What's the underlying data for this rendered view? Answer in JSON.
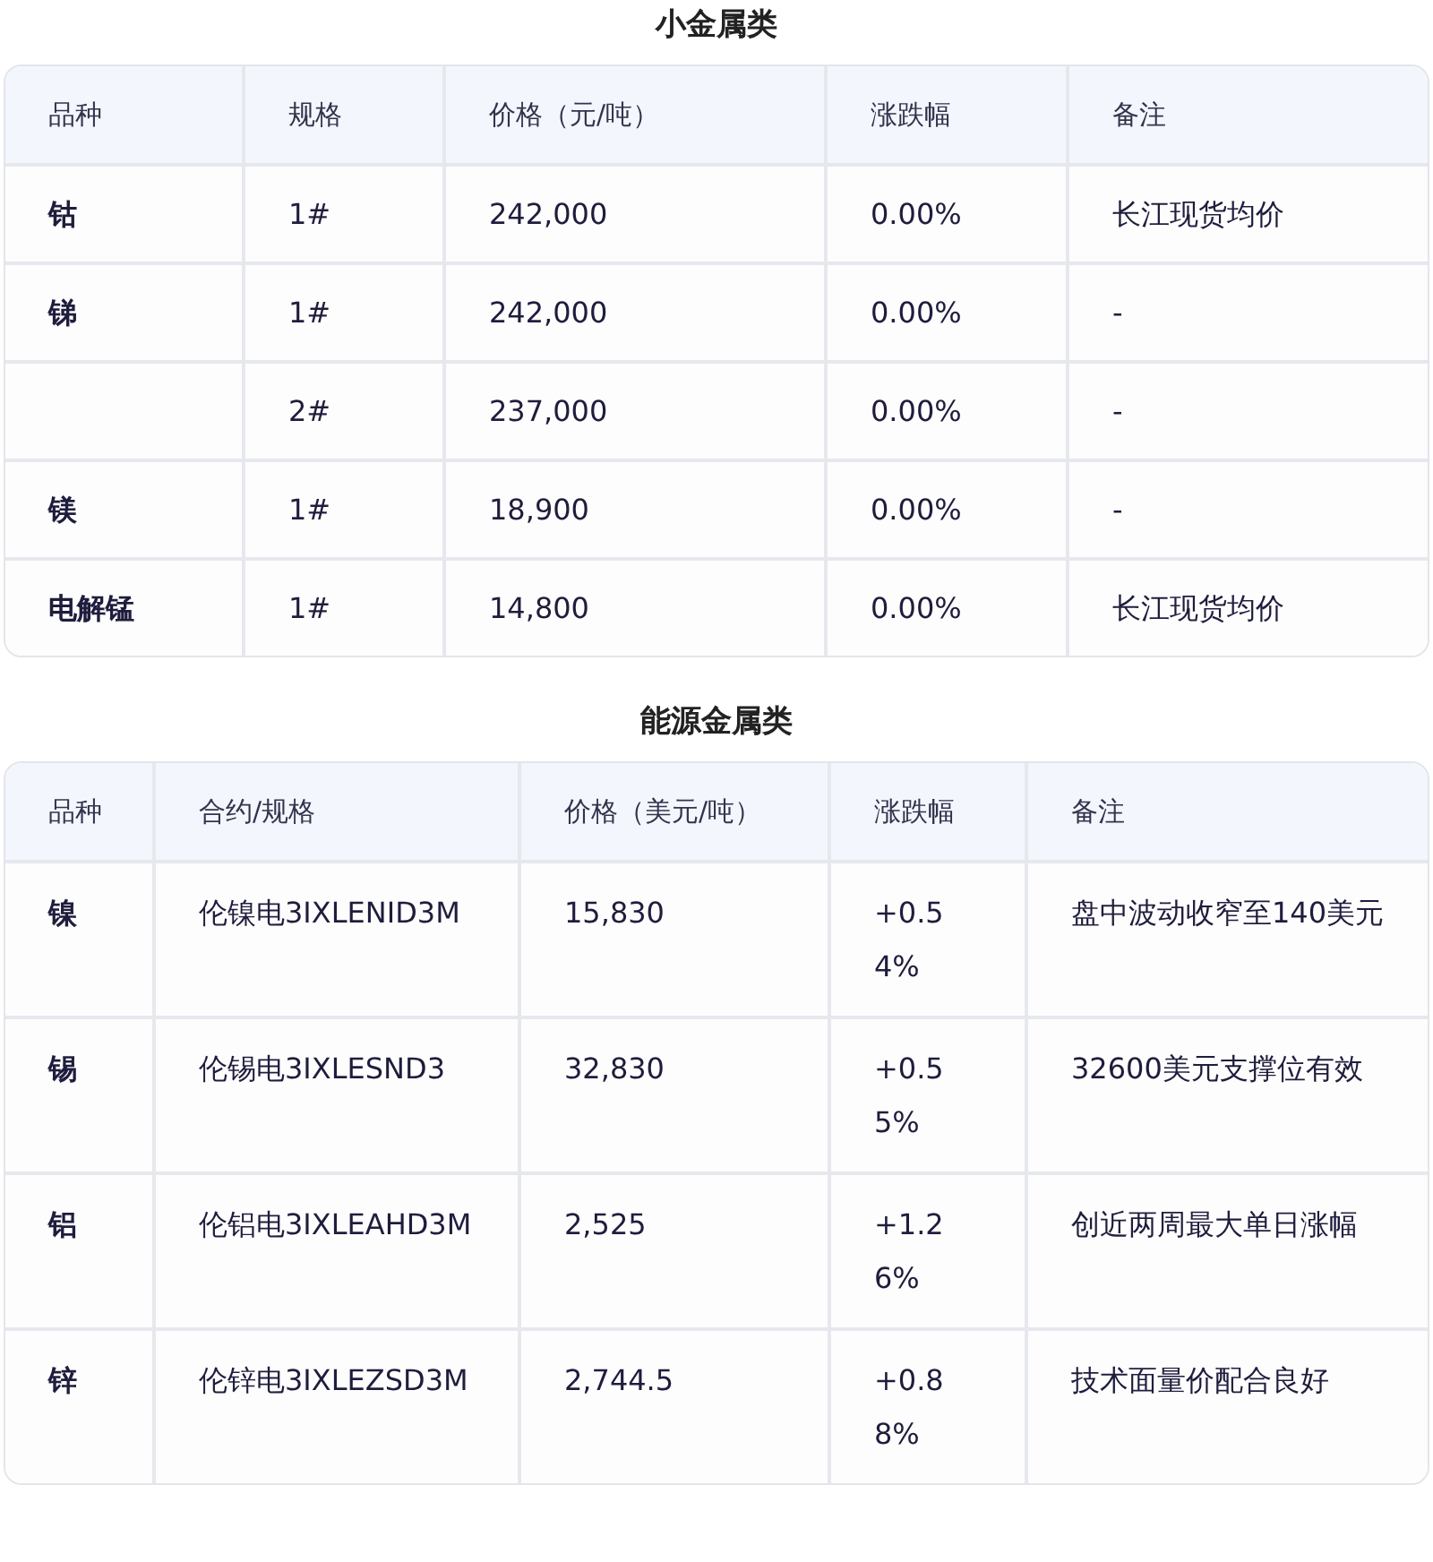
{
  "sections": [
    {
      "title": "小金属类",
      "columns": [
        "品种",
        "规格",
        "价格（元/吨）",
        "涨跌幅",
        "备注"
      ],
      "rows": [
        [
          "钴",
          "1#",
          "242,000",
          "0.00%",
          "长江现货均价"
        ],
        [
          "锑",
          "1#",
          "242,000",
          "0.00%",
          "-"
        ],
        [
          "",
          "2#",
          "237,000",
          "0.00%",
          "-"
        ],
        [
          "镁",
          "1#",
          "18,900",
          "0.00%",
          "-"
        ],
        [
          "电解锰",
          "1#",
          "14,800",
          "0.00%",
          "长江现货均价"
        ]
      ]
    },
    {
      "title": "能源金属类",
      "columns": [
        "品种",
        "合约/规格",
        "价格（美元/吨）",
        "涨跌幅",
        "备注"
      ],
      "rows": [
        [
          "镍",
          "伦镍电3IXLENID3M",
          "15,830",
          "+0.54%",
          "盘中波动收窄至140美元"
        ],
        [
          "锡",
          "伦锡电3IXLESND3",
          "32,830",
          "+0.55%",
          "32600美元支撑位有效"
        ],
        [
          "铝",
          "伦铝电3IXLEAHD3M",
          "2,525",
          "+1.26%",
          "创近两周最大单日涨幅"
        ],
        [
          "锌",
          "伦锌电3IXLEZSD3M",
          "2,744.5",
          "+0.88%",
          "技术面量价配合良好"
        ]
      ]
    }
  ]
}
